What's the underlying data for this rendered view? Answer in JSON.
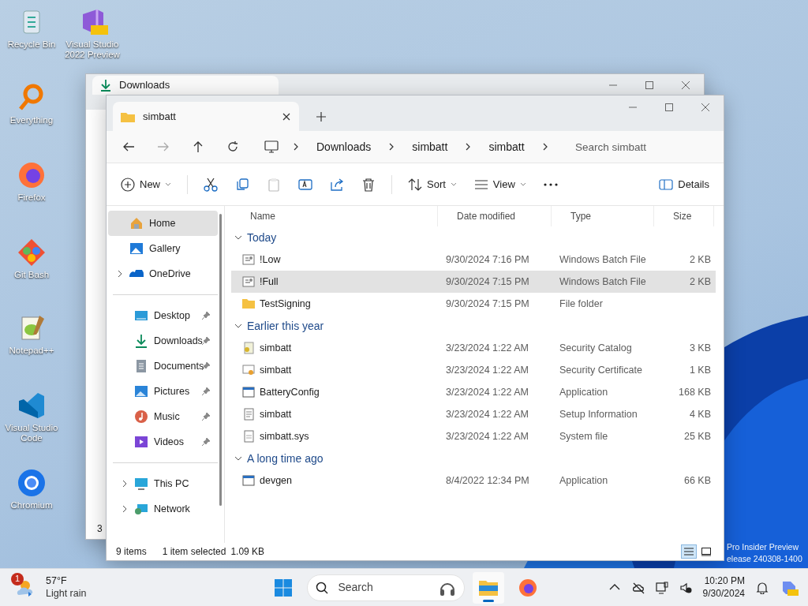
{
  "desktop_icons": [
    {
      "label": "Recycle Bin",
      "kind": "recycle"
    },
    {
      "label": "Visual Studio 2022 Preview",
      "kind": "vspre"
    },
    {
      "label": "Everything",
      "kind": "search"
    },
    {
      "label": "Firefox",
      "kind": "firefox"
    },
    {
      "label": "Git Bash",
      "kind": "git"
    },
    {
      "label": "Notepad++",
      "kind": "notepad"
    },
    {
      "label": "Visual Studio Code",
      "kind": "vscode"
    },
    {
      "label": "Chromium",
      "kind": "chromium"
    }
  ],
  "desktop_watermark": [
    "Pro Insider Preview",
    "elease 240308-1400"
  ],
  "back_window": {
    "tab": "Downloads",
    "status": "3"
  },
  "window": {
    "tabs": [
      {
        "label": "simbatt",
        "selected": true
      }
    ],
    "address": [
      "Downloads",
      "simbatt",
      "simbatt"
    ],
    "search": {
      "placeholder": "Search simbatt"
    },
    "toolbar": {
      "new_label": "New",
      "paste_disabled": true,
      "sort_label": "Sort",
      "view_label": "View",
      "details_label": "Details"
    },
    "sidebar": [
      [
        {
          "label": "Home",
          "kind": "home",
          "expandable": false,
          "pinned": false,
          "selected": true
        },
        {
          "label": "Gallery",
          "kind": "gallery",
          "expandable": false,
          "pinned": false,
          "selected": false
        },
        {
          "label": "OneDrive",
          "kind": "onedrive",
          "expandable": true,
          "pinned": false,
          "selected": false
        }
      ],
      [
        {
          "label": "Desktop",
          "kind": "desktop",
          "expandable": false,
          "pinned": true,
          "selected": false
        },
        {
          "label": "Downloads",
          "kind": "downloads",
          "expandable": false,
          "pinned": true,
          "selected": false
        },
        {
          "label": "Documents",
          "kind": "documents",
          "expandable": false,
          "pinned": true,
          "selected": false
        },
        {
          "label": "Pictures",
          "kind": "pictures",
          "expandable": false,
          "pinned": true,
          "selected": false
        },
        {
          "label": "Music",
          "kind": "music",
          "expandable": false,
          "pinned": true,
          "selected": false
        },
        {
          "label": "Videos",
          "kind": "videos",
          "expandable": false,
          "pinned": true,
          "selected": false
        }
      ],
      [
        {
          "label": "This PC",
          "kind": "thispc",
          "expandable": true,
          "pinned": false,
          "selected": false
        },
        {
          "label": "Network",
          "kind": "network",
          "expandable": true,
          "pinned": false,
          "selected": false
        }
      ]
    ],
    "columns": [
      "Name",
      "Date modified",
      "Type",
      "Size"
    ],
    "groups": [
      {
        "title": "Today",
        "expanded": true,
        "rows": [
          {
            "name": "!Low",
            "date": "9/30/2024 7:16 PM",
            "type": "Windows Batch File",
            "size": "2 KB",
            "kind": "batch",
            "selected": false
          },
          {
            "name": "!Full",
            "date": "9/30/2024 7:15 PM",
            "type": "Windows Batch File",
            "size": "2 KB",
            "kind": "batch",
            "selected": true
          },
          {
            "name": "TestSigning",
            "date": "9/30/2024 7:15 PM",
            "type": "File folder",
            "size": "",
            "kind": "folder",
            "selected": false
          }
        ]
      },
      {
        "title": "Earlier this year",
        "expanded": true,
        "rows": [
          {
            "name": "simbatt",
            "date": "3/23/2024 1:22 AM",
            "type": "Security Catalog",
            "size": "3 KB",
            "kind": "catalog",
            "selected": false
          },
          {
            "name": "simbatt",
            "date": "3/23/2024 1:22 AM",
            "type": "Security Certificate",
            "size": "1 KB",
            "kind": "certificate",
            "selected": false
          },
          {
            "name": "BatteryConfig",
            "date": "3/23/2024 1:22 AM",
            "type": "Application",
            "size": "168 KB",
            "kind": "application",
            "selected": false
          },
          {
            "name": "simbatt",
            "date": "3/23/2024 1:22 AM",
            "type": "Setup Information",
            "size": "4 KB",
            "kind": "setup",
            "selected": false
          },
          {
            "name": "simbatt.sys",
            "date": "3/23/2024 1:22 AM",
            "type": "System file",
            "size": "25 KB",
            "kind": "system",
            "selected": false
          }
        ]
      },
      {
        "title": "A long time ago",
        "expanded": true,
        "rows": [
          {
            "name": "devgen",
            "date": "8/4/2022 12:34 PM",
            "type": "Application",
            "size": "66 KB",
            "kind": "application",
            "selected": false
          }
        ]
      }
    ],
    "status_bar": {
      "count": "9 items",
      "selection": "1 item selected",
      "size": "1.09 KB"
    },
    "view_toggles": [
      {
        "kind": "details",
        "selected": true
      },
      {
        "kind": "tiles",
        "selected": false
      }
    ]
  },
  "taskbar": {
    "weather": {
      "badge": "1",
      "temp": "57°F",
      "condition": "Light rain"
    },
    "search": {
      "placeholder": "Search"
    },
    "apps": [
      {
        "kind": "explorer",
        "active": true
      },
      {
        "kind": "firefox",
        "active": false
      }
    ],
    "time": "10:20 PM",
    "date": "9/30/2024"
  }
}
